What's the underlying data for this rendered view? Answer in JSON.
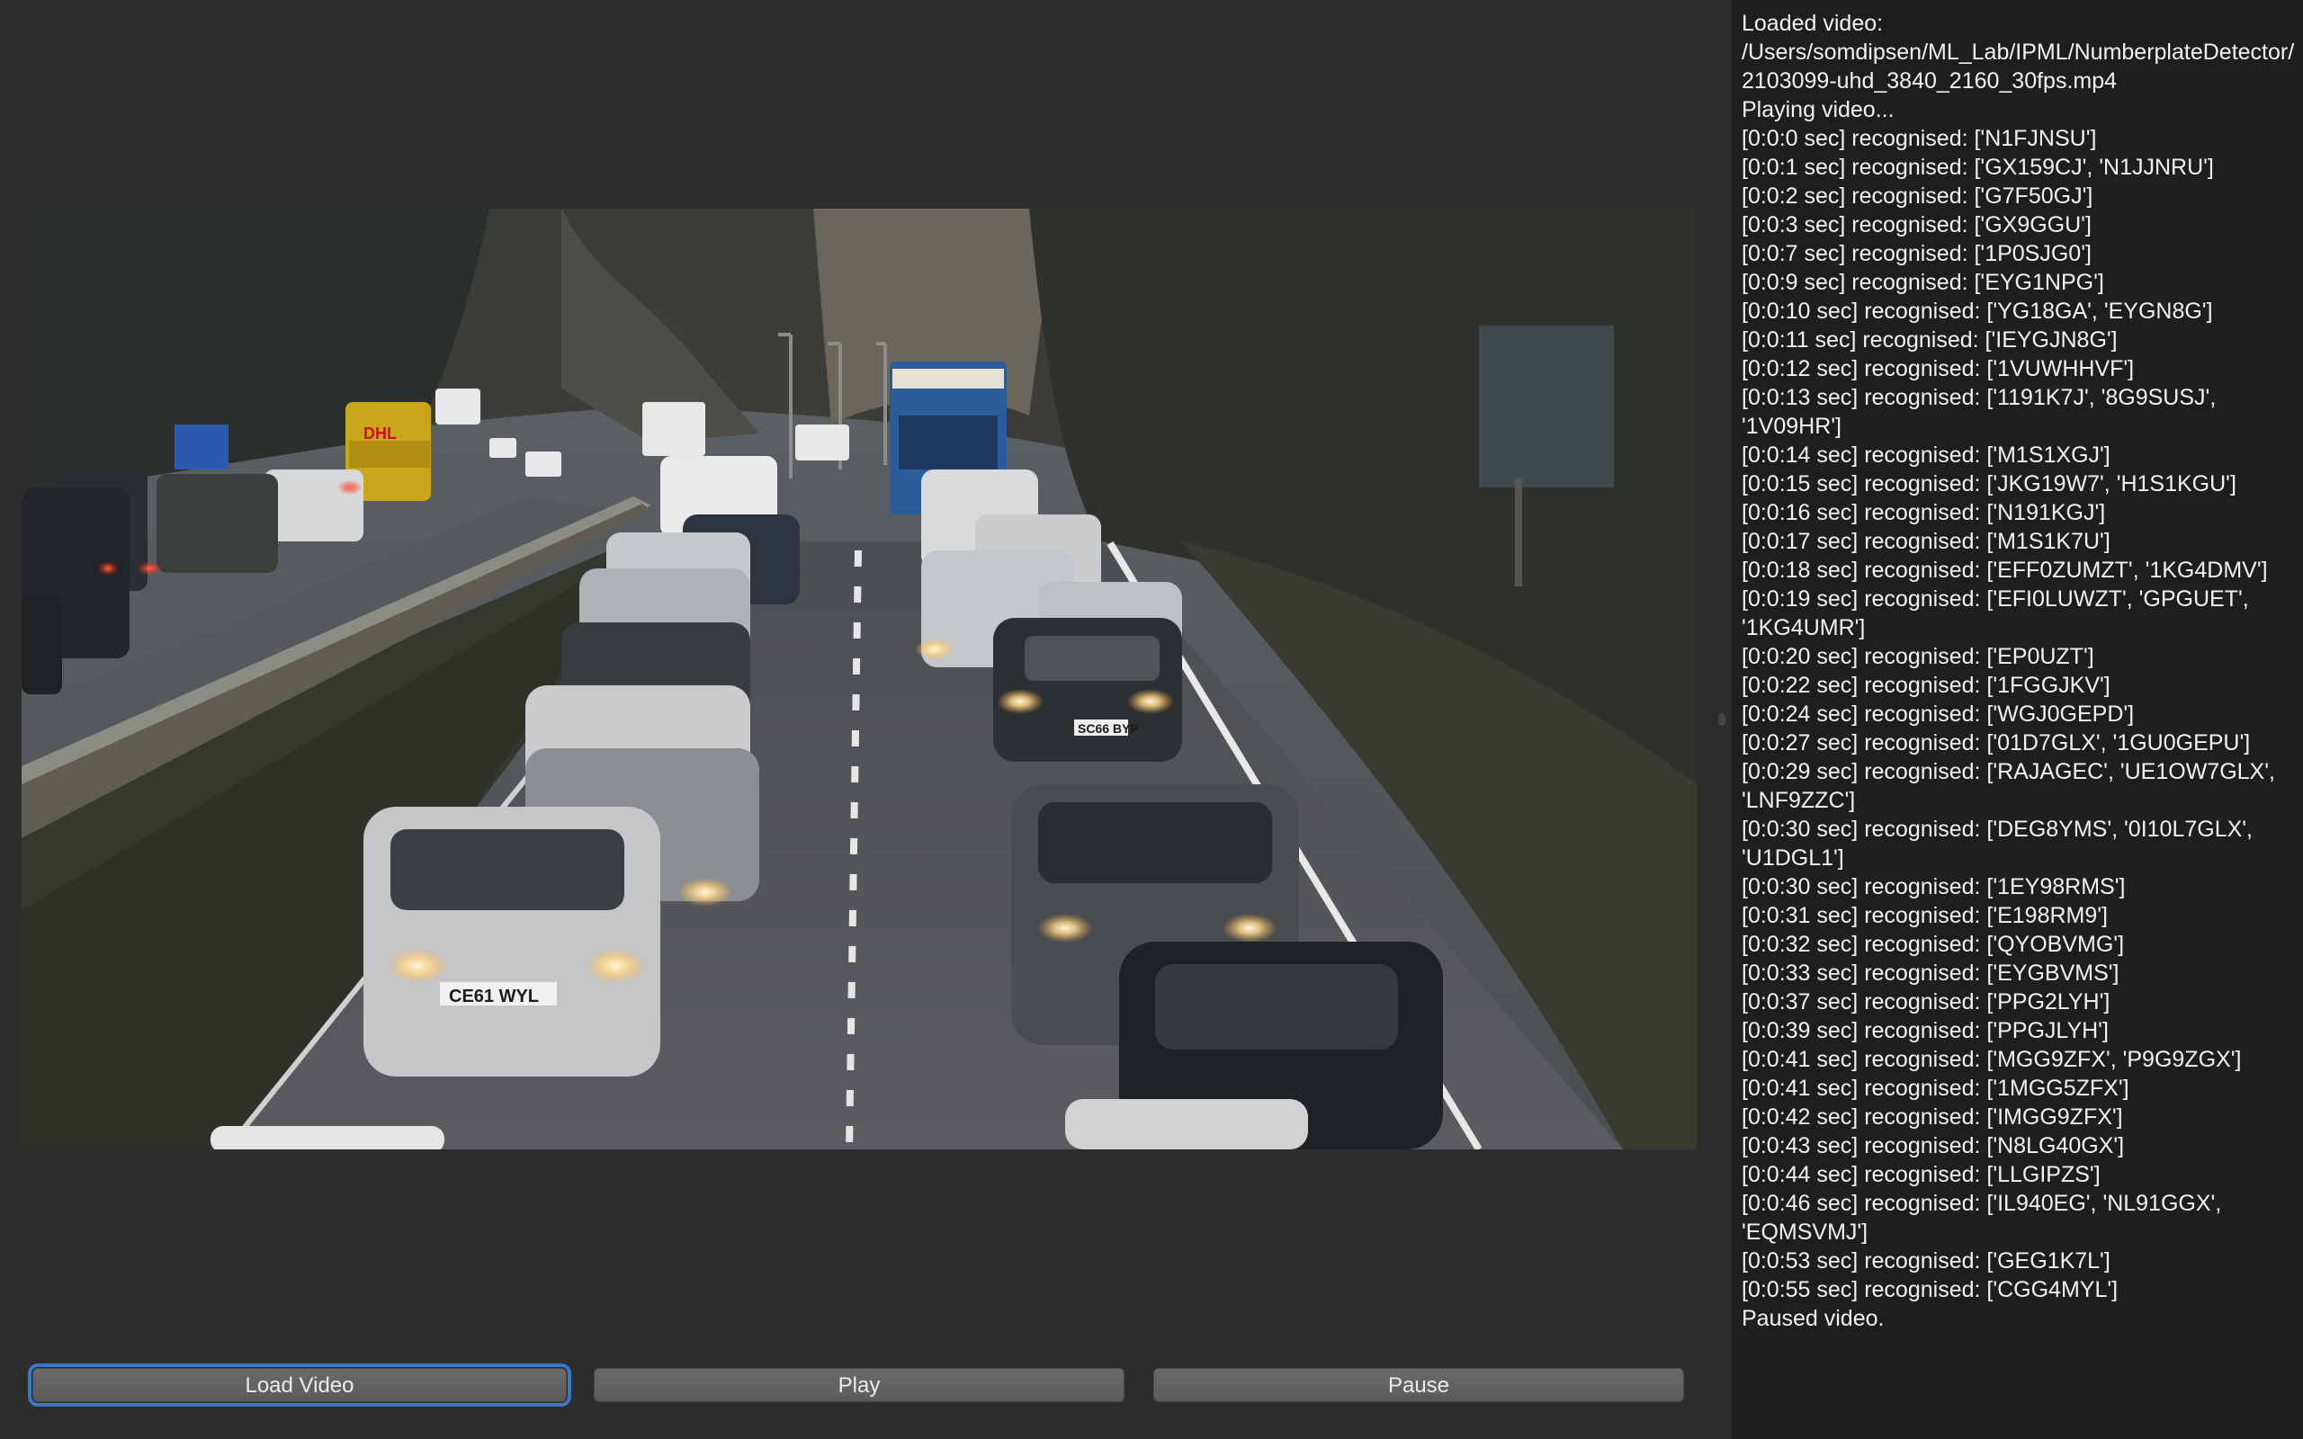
{
  "buttons": {
    "load": "Load Video",
    "play": "Play",
    "pause": "Pause"
  },
  "video": {
    "plates": [
      "CE61 WYL",
      "SC66 BYP"
    ]
  },
  "log": [
    "Loaded video: /Users/somdipsen/ML_Lab/IPML/NumberplateDetector/2103099-uhd_3840_2160_30fps.mp4",
    "Playing video...",
    "[0:0:0 sec] recognised: ['N1FJNSU']",
    "[0:0:1 sec] recognised: ['GX159CJ', 'N1JJNRU']",
    "[0:0:2 sec] recognised: ['G7F50GJ']",
    "[0:0:3 sec] recognised: ['GX9GGU']",
    "[0:0:7 sec] recognised: ['1P0SJG0']",
    "[0:0:9 sec] recognised: ['EYG1NPG']",
    "[0:0:10 sec] recognised: ['YG18GA', 'EYGN8G']",
    "[0:0:11 sec] recognised: ['IEYGJN8G']",
    "[0:0:12 sec] recognised: ['1VUWHHVF']",
    "[0:0:13 sec] recognised: ['1191K7J', '8G9SUSJ', '1V09HR']",
    "[0:0:14 sec] recognised: ['M1S1XGJ']",
    "[0:0:15 sec] recognised: ['JKG19W7', 'H1S1KGU']",
    "[0:0:16 sec] recognised: ['N191KGJ']",
    "[0:0:17 sec] recognised: ['M1S1K7U']",
    "[0:0:18 sec] recognised: ['EFF0ZUMZT', '1KG4DMV']",
    "[0:0:19 sec] recognised: ['EFI0LUWZT', 'GPGUET', '1KG4UMR']",
    "[0:0:20 sec] recognised: ['EP0UZT']",
    "[0:0:22 sec] recognised: ['1FGGJKV']",
    "[0:0:24 sec] recognised: ['WGJ0GEPD']",
    "[0:0:27 sec] recognised: ['01D7GLX', '1GU0GEPU']",
    "[0:0:29 sec] recognised: ['RAJAGEC', 'UE1OW7GLX', 'LNF9ZZC']",
    "[0:0:30 sec] recognised: ['DEG8YMS', '0I10L7GLX', 'U1DGL1']",
    "[0:0:30 sec] recognised: ['1EY98RMS']",
    "[0:0:31 sec] recognised: ['E198RM9']",
    "[0:0:32 sec] recognised: ['QYOBVMG']",
    "[0:0:33 sec] recognised: ['EYGBVMS']",
    "[0:0:37 sec] recognised: ['PPG2LYH']",
    "[0:0:39 sec] recognised: ['PPGJLYH']",
    "[0:0:41 sec] recognised: ['MGG9ZFX', 'P9G9ZGX']",
    "[0:0:41 sec] recognised: ['1MGG5ZFX']",
    "[0:0:42 sec] recognised: ['IMGG9ZFX']",
    "[0:0:43 sec] recognised: ['N8LG40GX']",
    "[0:0:44 sec] recognised: ['LLGIPZS']",
    "[0:0:46 sec] recognised: ['IL940EG', 'NL91GGX', 'EQMSVMJ']",
    "[0:0:53 sec] recognised: ['GEG1K7L']",
    "[0:0:55 sec] recognised: ['CGG4MYL']",
    "Paused video."
  ],
  "colors": {
    "background": "#2d2d2d",
    "log_background": "#1e1e1e",
    "focus_ring": "#3679c6"
  }
}
